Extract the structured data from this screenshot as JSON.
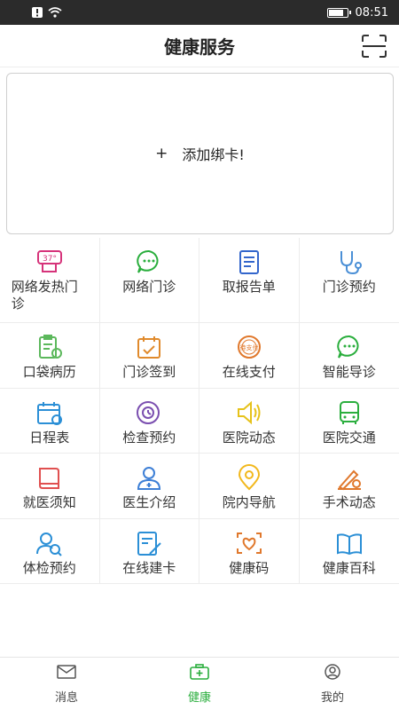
{
  "status": {
    "time": "08:51",
    "battery_level": 0.85
  },
  "header": {
    "title": "健康服务",
    "scan_icon": "scan-icon"
  },
  "card": {
    "plus": "+",
    "add_text": "添加绑卡!"
  },
  "services": [
    {
      "label": "网络发热门诊",
      "icon": "fever-clinic-icon",
      "color": "#d6337a"
    },
    {
      "label": "网络门诊",
      "icon": "online-clinic-icon",
      "color": "#2aae3d"
    },
    {
      "label": "取报告单",
      "icon": "report-icon",
      "color": "#3366cc"
    },
    {
      "label": "门诊预约",
      "icon": "stethoscope-icon",
      "color": "#4a8fd6"
    },
    {
      "label": "口袋病历",
      "icon": "medical-record-icon",
      "color": "#5cb85c"
    },
    {
      "label": "门诊签到",
      "icon": "checkin-calendar-icon",
      "color": "#e08a2c"
    },
    {
      "label": "在线支付",
      "icon": "payment-stamp-icon",
      "color": "#e0782c"
    },
    {
      "label": "智能导诊",
      "icon": "smart-guide-icon",
      "color": "#2aae3d"
    },
    {
      "label": "日程表",
      "icon": "schedule-icon",
      "color": "#2b8fd6"
    },
    {
      "label": "检查预约",
      "icon": "exam-appointment-icon",
      "color": "#7b4fb0"
    },
    {
      "label": "医院动态",
      "icon": "speaker-icon",
      "color": "#e6c21a"
    },
    {
      "label": "医院交通",
      "icon": "bus-icon",
      "color": "#2aae3d"
    },
    {
      "label": "就医须知",
      "icon": "book-icon",
      "color": "#e05050"
    },
    {
      "label": "医生介绍",
      "icon": "doctor-icon",
      "color": "#3d7fd6"
    },
    {
      "label": "院内导航",
      "icon": "location-pin-icon",
      "color": "#f2b81d"
    },
    {
      "label": "手术动态",
      "icon": "surgery-icon",
      "color": "#e0782c"
    },
    {
      "label": "体检预约",
      "icon": "physical-exam-icon",
      "color": "#2b8fd6"
    },
    {
      "label": "在线建卡",
      "icon": "create-card-icon",
      "color": "#2b8fd6"
    },
    {
      "label": "健康码",
      "icon": "health-code-icon",
      "color": "#e0782c"
    },
    {
      "label": "健康百科",
      "icon": "encyclopedia-icon",
      "color": "#2b8fd6"
    }
  ],
  "tabs": [
    {
      "label": "消息",
      "icon": "mail-icon",
      "active": false
    },
    {
      "label": "健康",
      "icon": "medical-kit-icon",
      "active": true
    },
    {
      "label": "我的",
      "icon": "user-icon",
      "active": false
    }
  ],
  "colors": {
    "accent": "#2aae3d"
  }
}
